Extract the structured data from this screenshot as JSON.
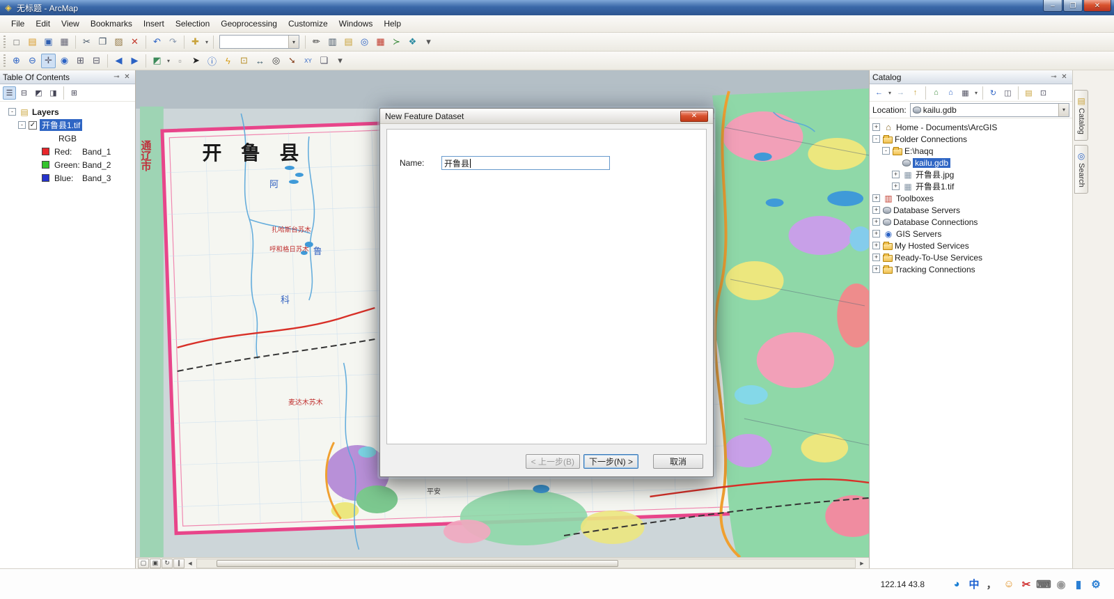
{
  "window": {
    "title": "无标题 - ArcMap",
    "minimize_glyph": "–",
    "maximize_glyph": "❐",
    "close_glyph": "✕"
  },
  "icons": {
    "app": "◈",
    "pin": "⊸",
    "close": "✕",
    "check": "✓",
    "dropdown": "▾"
  },
  "menu": {
    "items": [
      {
        "name": "menu-file",
        "label": "File"
      },
      {
        "name": "menu-edit",
        "label": "Edit"
      },
      {
        "name": "menu-view",
        "label": "View"
      },
      {
        "name": "menu-bookmarks",
        "label": "Bookmarks"
      },
      {
        "name": "menu-insert",
        "label": "Insert"
      },
      {
        "name": "menu-selection",
        "label": "Selection"
      },
      {
        "name": "menu-geoprocessing",
        "label": "Geoprocessing"
      },
      {
        "name": "menu-customize",
        "label": "Customize"
      },
      {
        "name": "menu-windows",
        "label": "Windows"
      },
      {
        "name": "menu-help",
        "label": "Help"
      }
    ]
  },
  "toolbar_standard": {
    "scale_value": "",
    "buttons": [
      {
        "grip": true
      },
      {
        "name": "new-document-button",
        "glyph": "□",
        "color": "#555"
      },
      {
        "name": "open-document-button",
        "glyph": "▤",
        "color": "#d89a28"
      },
      {
        "name": "save-document-button",
        "glyph": "▣",
        "color": "#2f5fb0"
      },
      {
        "name": "print-button",
        "glyph": "▦",
        "color": "#667"
      },
      {
        "sep": true
      },
      {
        "name": "cut-button",
        "glyph": "✂",
        "color": "#456"
      },
      {
        "name": "copy-button",
        "glyph": "❐",
        "color": "#456"
      },
      {
        "name": "paste-button",
        "glyph": "▨",
        "color": "#967c4a"
      },
      {
        "name": "delete-button",
        "glyph": "✕",
        "color": "#c33b2e"
      },
      {
        "sep": true
      },
      {
        "name": "undo-button",
        "glyph": "↶",
        "color": "#2b62c4"
      },
      {
        "name": "redo-button",
        "glyph": "↷",
        "color": "#8a9ab0"
      },
      {
        "sep": true
      },
      {
        "name": "add-data-button",
        "glyph": "✚",
        "color": "#c8a23a",
        "dropdown": true
      },
      {
        "sep": true
      },
      {
        "combo": true
      },
      {
        "sep": true
      },
      {
        "name": "editor-toolbar-button",
        "glyph": "✏",
        "color": "#333"
      },
      {
        "name": "attribute-table-button",
        "glyph": "▥",
        "color": "#456"
      },
      {
        "name": "catalog-window-button",
        "glyph": "▤",
        "color": "#c8a23a"
      },
      {
        "name": "search-window-button",
        "glyph": "◎",
        "color": "#2b62c4"
      },
      {
        "name": "arctoolbox-button",
        "glyph": "▦",
        "color": "#c0392b"
      },
      {
        "name": "python-window-button",
        "glyph": "≻",
        "color": "#3a8a3a"
      },
      {
        "name": "modelbuilder-button",
        "glyph": "❖",
        "color": "#2a8aa0"
      },
      {
        "name": "toolbar-options-chevron",
        "glyph": "▾",
        "color": "#555"
      }
    ]
  },
  "toolbar_tools": {
    "buttons": [
      {
        "grip": true
      },
      {
        "name": "zoom-in-tool",
        "glyph": "⊕",
        "color": "#2b62c4"
      },
      {
        "name": "zoom-out-tool",
        "glyph": "⊖",
        "color": "#2b62c4"
      },
      {
        "name": "pan-tool",
        "glyph": "✛",
        "color": "#556",
        "pressed": true
      },
      {
        "name": "full-extent-tool",
        "glyph": "◉",
        "color": "#2b62c4"
      },
      {
        "name": "fixed-zoom-in-tool",
        "glyph": "⊞",
        "color": "#556"
      },
      {
        "name": "fixed-zoom-out-tool",
        "glyph": "⊟",
        "color": "#556"
      },
      {
        "sep": true
      },
      {
        "name": "go-back-extent-button",
        "glyph": "◀",
        "color": "#2b62c4"
      },
      {
        "name": "go-forward-extent-button",
        "glyph": "▶",
        "color": "#2b62c4"
      },
      {
        "sep": true
      },
      {
        "name": "select-features-tool",
        "glyph": "◩",
        "color": "#3c8a5a",
        "dropdown": true
      },
      {
        "name": "clear-selection-button",
        "glyph": "▫",
        "color": "#888"
      },
      {
        "name": "select-elements-tool",
        "glyph": "➤",
        "color": "#222"
      },
      {
        "name": "identify-tool",
        "glyph": "ⓘ",
        "color": "#2b62c4"
      },
      {
        "name": "hyperlink-tool",
        "glyph": "ϟ",
        "color": "#d8a020"
      },
      {
        "name": "html-popup-tool",
        "glyph": "⊡",
        "color": "#b8902a"
      },
      {
        "name": "measure-tool",
        "glyph": "↔",
        "color": "#356"
      },
      {
        "name": "find-button",
        "glyph": "◎",
        "color": "#333"
      },
      {
        "name": "find-route-button",
        "glyph": "➘",
        "color": "#884422"
      },
      {
        "name": "go-to-xy-button",
        "glyph": "XY",
        "color": "#2b62c4",
        "fs": 8
      },
      {
        "name": "open-viewer-window-button",
        "glyph": "❏",
        "color": "#556"
      },
      {
        "name": "tools-options-chevron",
        "glyph": "▾",
        "color": "#555"
      }
    ]
  },
  "toc": {
    "title": "Table Of Contents",
    "toolbar": [
      {
        "name": "list-by-drawing-order-button",
        "glyph": "☰",
        "color": "#445",
        "pressed": true
      },
      {
        "name": "list-by-source-button",
        "glyph": "⊟",
        "color": "#445"
      },
      {
        "name": "list-by-visibility-button",
        "glyph": "◩",
        "color": "#445"
      },
      {
        "name": "list-by-selection-button",
        "glyph": "◨",
        "color": "#445"
      },
      {
        "sep": true
      },
      {
        "name": "toc-options-button",
        "glyph": "⊞",
        "color": "#445"
      }
    ],
    "tree": {
      "root_expand": "-",
      "root_label": "Layers",
      "layer_expand": "-",
      "layer_label": "开鲁县1.tif",
      "render_label": "RGB",
      "bands": [
        {
          "swatch": "#e8262b",
          "channel": "Red:",
          "band": "Band_1"
        },
        {
          "swatch": "#35c42e",
          "channel": "Green:",
          "band": "Band_2"
        },
        {
          "swatch": "#2633cc",
          "channel": "Blue:",
          "band": "Band_3"
        }
      ]
    }
  },
  "map": {
    "title": "开 鲁 县",
    "city_label": "通辽市",
    "labels": [
      "扎哈斯台苏木",
      "呼和格日苏木",
      "麦达木苏木",
      "平安",
      "阿",
      "科",
      "鲁"
    ]
  },
  "map_controls": {
    "scroll_left_glyph": "◀",
    "scroll_right_glyph": "▶",
    "buttons": [
      {
        "name": "data-view-button",
        "glyph": "▢"
      },
      {
        "name": "layout-view-button",
        "glyph": "▣"
      },
      {
        "name": "refresh-view-button",
        "glyph": "↻"
      },
      {
        "name": "pause-drawing-button",
        "glyph": "∥"
      }
    ]
  },
  "catalog": {
    "title": "Catalog",
    "location_label": "Location:",
    "location_value": "kailu.gdb",
    "toolbar": [
      {
        "name": "catalog-back-button",
        "glyph": "←",
        "color": "#2b62c4",
        "dropdown": true
      },
      {
        "name": "catalog-forward-button",
        "glyph": "→",
        "color": "#9ab0c8"
      },
      {
        "name": "up-one-level-button",
        "glyph": "↑",
        "color": "#c8a23a"
      },
      {
        "sep": true
      },
      {
        "name": "default-geodatabase-button",
        "glyph": "⌂",
        "color": "#3a8a3a"
      },
      {
        "name": "home-folder-button",
        "glyph": "⌂",
        "color": "#2b62c4"
      },
      {
        "name": "contents-view-button",
        "glyph": "▦",
        "color": "#556",
        "dropdown": true
      },
      {
        "sep": true
      },
      {
        "name": "refresh-button",
        "glyph": "↻",
        "color": "#2b62c4"
      },
      {
        "name": "toggle-contents-panel-button",
        "glyph": "◫",
        "color": "#556"
      },
      {
        "sep": true
      },
      {
        "name": "launch-arccatalog-button",
        "glyph": "▤",
        "color": "#c8a23a"
      },
      {
        "name": "catalog-options-button",
        "glyph": "⊡",
        "color": "#556"
      }
    ],
    "tree": [
      {
        "label": "Home - Documents\\ArcGIS",
        "expand": "+",
        "icon": "home",
        "indent": 0
      },
      {
        "label": "Folder Connections",
        "expand": "-",
        "icon": "folder-connections",
        "indent": 0
      },
      {
        "label": "E:\\haqq",
        "expand": "-",
        "icon": "folder",
        "indent": 1
      },
      {
        "label": "kailu.gdb",
        "expand": "",
        "icon": "geodatabase",
        "indent": 2,
        "selected": true
      },
      {
        "label": "开鲁县.jpg",
        "expand": "+",
        "icon": "raster",
        "indent": 2
      },
      {
        "label": "开鲁县1.tif",
        "expand": "+",
        "icon": "raster",
        "indent": 2
      },
      {
        "label": "Toolboxes",
        "expand": "+",
        "icon": "toolbox",
        "indent": 0
      },
      {
        "label": "Database Servers",
        "expand": "+",
        "icon": "database-servers",
        "indent": 0
      },
      {
        "label": "Database Connections",
        "expand": "+",
        "icon": "database-connections",
        "indent": 0
      },
      {
        "label": "GIS Servers",
        "expand": "+",
        "icon": "gis-servers",
        "indent": 0
      },
      {
        "label": "My Hosted Services",
        "expand": "+",
        "icon": "hosted-services",
        "indent": 0
      },
      {
        "label": "Ready-To-Use Services",
        "expand": "+",
        "icon": "ready-services",
        "indent": 0
      },
      {
        "label": "Tracking Connections",
        "expand": "+",
        "icon": "tracking-connections",
        "indent": 0
      }
    ]
  },
  "side_tabs": [
    {
      "name": "side-tab-catalog",
      "label": "Catalog"
    },
    {
      "name": "side-tab-search",
      "label": "Search"
    }
  ],
  "dialog": {
    "title": "New Feature Dataset",
    "name_label": "Name:",
    "name_value": "开鲁县",
    "back_label": "< 上一步(B)",
    "next_label": "下一步(N) >",
    "cancel_label": "取消"
  },
  "statusbar": {
    "coordinates": "122.14  43.8",
    "tray": [
      {
        "name": "tray-messenger-icon",
        "glyph": "◕",
        "color": "#1a7fd4"
      },
      {
        "name": "tray-ime-language-icon",
        "glyph": "中",
        "color": "#1a5fd0"
      },
      {
        "name": "tray-ime-punctuation-icon",
        "glyph": "，",
        "color": "#555"
      },
      {
        "name": "tray-emoji-icon",
        "glyph": "☺",
        "color": "#e09020"
      },
      {
        "name": "tray-scissors-icon",
        "glyph": "✂",
        "color": "#d03030"
      },
      {
        "name": "tray-keyboard-icon",
        "glyph": "⌨",
        "color": "#666"
      },
      {
        "name": "tray-user-icon",
        "glyph": "◉",
        "color": "#999"
      },
      {
        "name": "tray-briefcase-icon",
        "glyph": "▮",
        "color": "#2a7fd4"
      },
      {
        "name": "tray-settings-icon",
        "glyph": "⚙",
        "color": "#2a7fd4"
      }
    ]
  }
}
